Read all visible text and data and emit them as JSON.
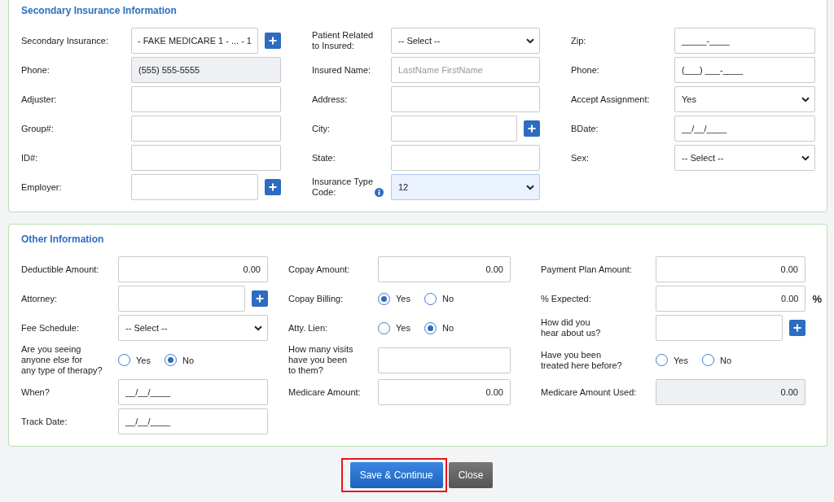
{
  "sections": [
    {
      "title": "Secondary Insurance Information",
      "columns": [
        [
          {
            "label": "Secondary Insurance:",
            "kind": "lookup",
            "value": "- FAKE MEDICARE 1 - ... - 1"
          },
          {
            "label": "Phone:",
            "kind": "readonly",
            "value": "(555) 555-5555"
          },
          {
            "label": "Adjuster:",
            "kind": "text"
          },
          {
            "label": "Group#:",
            "kind": "text"
          },
          {
            "label": "ID#:",
            "kind": "text"
          },
          {
            "label": "Employer:",
            "kind": "lookup"
          }
        ],
        [
          {
            "label": "Patient Related\nto Insured:",
            "kind": "select",
            "value": "-- Select --"
          },
          {
            "label": "Insured Name:",
            "kind": "text",
            "placeholder": "LastName FirstName"
          },
          {
            "label": "Address:",
            "kind": "text"
          },
          {
            "label": "City:",
            "kind": "lookup"
          },
          {
            "label": "State:",
            "kind": "text"
          },
          {
            "label": "Insurance Type\nCode:",
            "kind": "focused-select",
            "value": "12",
            "info_icon": true
          }
        ],
        [
          {
            "label": "Zip:",
            "kind": "text",
            "value": "_____-____"
          },
          {
            "label": "Phone:",
            "kind": "text",
            "value": "(___) ___-____"
          },
          {
            "label": "Accept Assignment:",
            "kind": "select",
            "value": "Yes"
          },
          {
            "label": "BDate:",
            "kind": "text",
            "value": "__/__/____"
          },
          {
            "label": "Sex:",
            "kind": "select",
            "value": "-- Select --"
          }
        ]
      ]
    },
    {
      "title": "Other Information",
      "columns": [
        [
          {
            "label": "Deductible Amount:",
            "kind": "amount",
            "value": "0.00"
          },
          {
            "label": "Attorney:",
            "kind": "lookup"
          },
          {
            "label": "Fee Schedule:",
            "kind": "select",
            "value": "-- Select --"
          },
          {
            "label": "Are you seeing\nanyone else for\nany type of therapy?",
            "kind": "radios",
            "options": [
              {
                "label": "Yes",
                "selected": false
              },
              {
                "label": "No",
                "selected": true
              }
            ]
          },
          {
            "label": "When?",
            "kind": "text",
            "value": "__/__/____"
          },
          {
            "label": "Track Date:",
            "kind": "text",
            "value": "__/__/____"
          }
        ],
        [
          {
            "label": "Copay Amount:",
            "kind": "amount",
            "value": "0.00"
          },
          {
            "label": "Copay Billing:",
            "kind": "radios",
            "options": [
              {
                "label": "Yes",
                "selected": true
              },
              {
                "label": "No",
                "selected": false
              }
            ]
          },
          {
            "label": "Atty. Lien:",
            "kind": "radios",
            "options": [
              {
                "label": "Yes",
                "selected": false
              },
              {
                "label": "No",
                "selected": true
              }
            ]
          },
          {
            "label": "How many visits\nhave you been\nto them?",
            "kind": "text"
          },
          {
            "label": "Medicare Amount:",
            "kind": "amount",
            "value": "0.00"
          }
        ],
        [
          {
            "label": "Payment Plan Amount:",
            "kind": "amount",
            "value": "0.00"
          },
          {
            "label": "% Expected:",
            "kind": "percent",
            "value": "0.00",
            "unit": "%"
          },
          {
            "label": "How did you\nhear about us?",
            "kind": "lookup"
          },
          {
            "label": "Have you been\ntreated here before?",
            "kind": "radios",
            "options": [
              {
                "label": "Yes",
                "selected": false
              },
              {
                "label": "No",
                "selected": false
              }
            ]
          },
          {
            "label": "Medicare Amount Used:",
            "kind": "readonly-amount",
            "value": "0.00"
          }
        ]
      ]
    }
  ],
  "buttons": [
    {
      "label": "Save & Continue",
      "kind": "primary",
      "highlighted": true
    },
    {
      "label": "Close",
      "kind": "secondary",
      "highlighted": false
    }
  ]
}
